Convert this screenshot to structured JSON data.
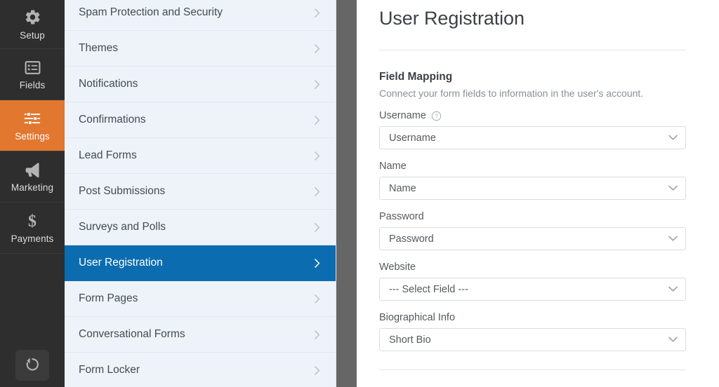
{
  "rail": {
    "items": [
      {
        "label": "Setup",
        "icon": "gear-icon",
        "active": false
      },
      {
        "label": "Fields",
        "icon": "list-box-icon",
        "active": false
      },
      {
        "label": "Settings",
        "icon": "sliders-icon",
        "active": true
      },
      {
        "label": "Marketing",
        "icon": "megaphone-icon",
        "active": false
      },
      {
        "label": "Payments",
        "icon": "dollar-sign-icon",
        "active": false
      }
    ],
    "bottom_button": {
      "name": "revisions-button",
      "icon": "history-revert-icon"
    },
    "active_color": "#e27730",
    "background_color": "#2e2e2e"
  },
  "menu": {
    "items": [
      {
        "label": "Spam Protection and Security",
        "active": false
      },
      {
        "label": "Themes",
        "active": false
      },
      {
        "label": "Notifications",
        "active": false
      },
      {
        "label": "Confirmations",
        "active": false
      },
      {
        "label": "Lead Forms",
        "active": false
      },
      {
        "label": "Post Submissions",
        "active": false
      },
      {
        "label": "Surveys and Polls",
        "active": false
      },
      {
        "label": "User Registration",
        "active": true
      },
      {
        "label": "Form Pages",
        "active": false
      },
      {
        "label": "Conversational Forms",
        "active": false
      },
      {
        "label": "Form Locker",
        "active": false
      }
    ],
    "chevron_icon": "chevron-right-icon",
    "active_color": "#0b6daf",
    "background_color": "#eef3fa"
  },
  "content": {
    "page_title": "User Registration",
    "section": {
      "title": "Field Mapping",
      "description": "Connect your form fields to information in the user's account."
    },
    "fields": [
      {
        "label": "Username",
        "value": "Username",
        "has_help": true
      },
      {
        "label": "Name",
        "value": "Name",
        "has_help": false
      },
      {
        "label": "Password",
        "value": "Password",
        "has_help": false
      },
      {
        "label": "Website",
        "value": "--- Select Field ---",
        "has_help": false
      },
      {
        "label": "Biographical Info",
        "value": "Short Bio",
        "has_help": false
      }
    ],
    "select_chevron_icon": "chevron-down-icon",
    "help_icon": "question-circle-icon"
  }
}
